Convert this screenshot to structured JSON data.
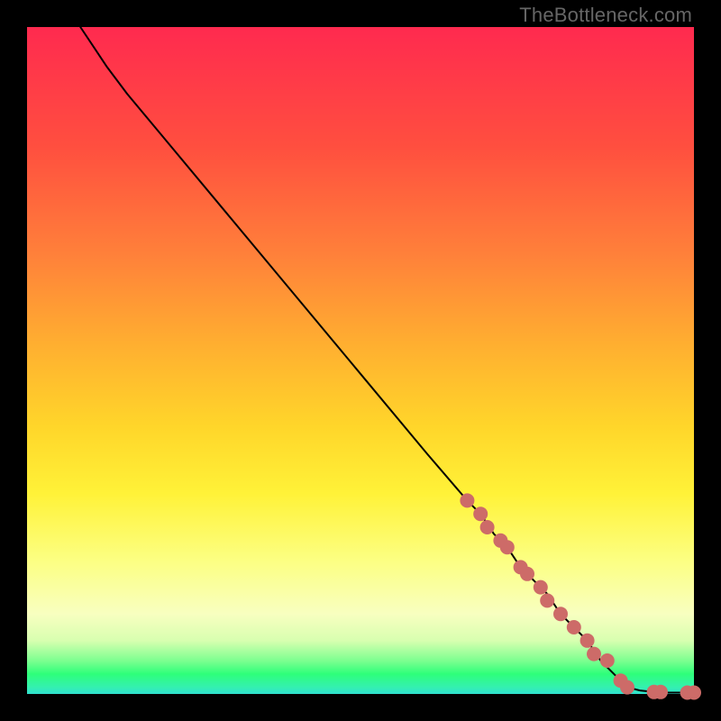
{
  "watermark": "TheBottleneck.com",
  "colors": {
    "curve": "#000000",
    "marker_fill": "#cd6b68",
    "background_black": "#000000"
  },
  "chart_data": {
    "type": "line",
    "title": "",
    "xlabel": "",
    "ylabel": "",
    "xlim": [
      0,
      100
    ],
    "ylim": [
      0,
      100
    ],
    "grid": false,
    "legend": false,
    "series": [
      {
        "name": "curve",
        "x": [
          8,
          10,
          12,
          15,
          20,
          30,
          40,
          50,
          60,
          66,
          68,
          70,
          72,
          74,
          76,
          78,
          80,
          82,
          84,
          86,
          88,
          89,
          90,
          92,
          94,
          96,
          98,
          100
        ],
        "y": [
          100,
          97,
          94,
          90,
          84,
          72,
          60,
          48,
          36,
          29,
          27,
          24,
          22,
          19,
          17,
          15,
          12,
          10,
          8,
          5,
          3,
          2,
          1,
          0.5,
          0.3,
          0.2,
          0.2,
          0.2
        ]
      }
    ],
    "markers": {
      "name": "highlighted-points",
      "color": "#cd6b68",
      "x": [
        66,
        68,
        69,
        71,
        72,
        74,
        75,
        77,
        78,
        80,
        82,
        84,
        85,
        87,
        89,
        90,
        94,
        95,
        99,
        100
      ],
      "y": [
        29,
        27,
        25,
        23,
        22,
        19,
        18,
        16,
        14,
        12,
        10,
        8,
        6,
        5,
        2,
        1,
        0.3,
        0.3,
        0.2,
        0.2
      ]
    }
  }
}
